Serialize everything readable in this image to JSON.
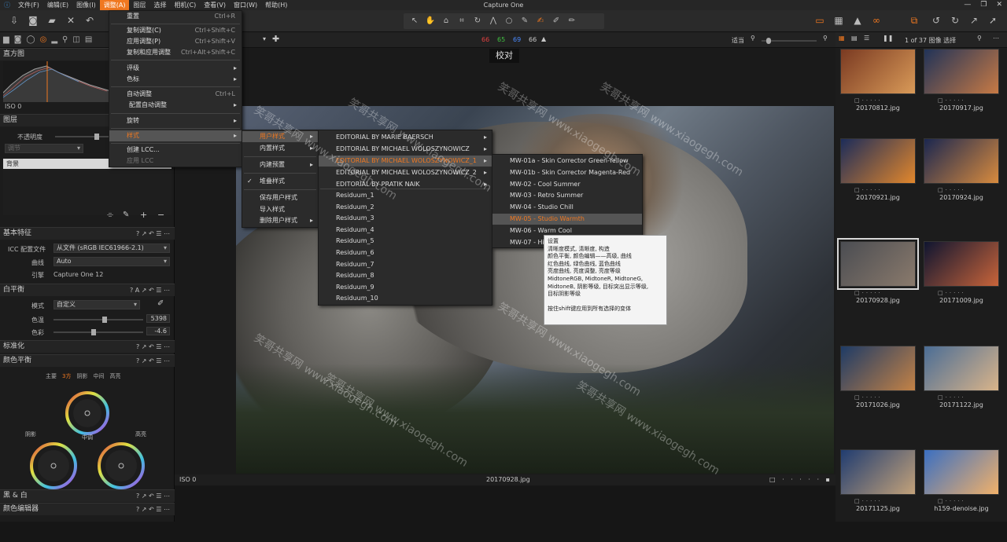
{
  "app": {
    "title": "Capture One"
  },
  "menubar": {
    "items": [
      "文件(F)",
      "编辑(E)",
      "图像(I)",
      "调整(A)",
      "图层",
      "选择",
      "相机(C)",
      "查看(V)",
      "窗口(W)",
      "帮助(H)"
    ],
    "active_index": 3
  },
  "viewer": {
    "label": "校对",
    "tabs_counts": [
      "66",
      "65",
      "69",
      "66"
    ],
    "fit_label": "适当",
    "filename": "20170928.jpg",
    "iso": "ISO 0"
  },
  "browser": {
    "count": "1 of 37 图像 选择"
  },
  "menus": {
    "adjust": [
      {
        "t": "重置",
        "s": "Ctrl+R"
      },
      {
        "t": "复制调整(C)",
        "s": "Ctrl+Shift+C"
      },
      {
        "t": "应用调整(P)",
        "s": "Ctrl+Shift+V"
      },
      {
        "t": "复制和应用调整",
        "s": "Ctrl+Alt+Shift+C"
      },
      {
        "t": "评级",
        "s": ""
      },
      {
        "t": "色标",
        "s": ""
      },
      {
        "t": "自动调整",
        "s": "Ctrl+L"
      },
      {
        "t": "配置自动调整",
        "s": ""
      },
      {
        "t": "旋转",
        "s": ""
      },
      {
        "t": "样式",
        "s": ""
      },
      {
        "t": "创建 LCC...",
        "s": ""
      },
      {
        "t": "应用 LCC",
        "s": ""
      }
    ],
    "styles": [
      "用户样式",
      "内置样式",
      "内建预置",
      "堆叠样式",
      "保存用户样式",
      "导入样式",
      "删除用户样式"
    ],
    "user_styles": [
      "EDITORIAL BY MARIE BAERSCH",
      "EDITORIAL BY MICHAEL WOLOSZYNOWICZ",
      "EDITORIAL BY MICHAEL WOLOSZYNOWICZ_1",
      "EDITORIAL BY MICHAEL WOLOSZYNOWICZ_2",
      "EDITORIAL BY PRATIK NAIK",
      "Residuum_1",
      "Residuum_2",
      "Residuum_3",
      "Residuum_4",
      "Residuum_5",
      "Residuum_6",
      "Residuum_7",
      "Residuum_8",
      "Residuum_9",
      "Residuum_10"
    ],
    "mw": [
      "MW-01a - Skin Corrector Green-Yellow",
      "MW-01b - Skin Corrector Magenta-Red",
      "MW-02 - Cool Summer",
      "MW-03 - Retro Summer",
      "MW-04 - Studio Chill",
      "MW-05 - Studio Warmth",
      "MW-06 - Warm Cool",
      "MW-07 - Hi"
    ]
  },
  "tooltip": {
    "lines": [
      "设置",
      "清晰度模式, 清晰度, 构造",
      "颜色平衡, 颜色编辑——高级, 曲线",
      "红色曲线, 绿色曲线, 蓝色曲线",
      "亮度曲线, 亮度调整, 亮度等级",
      "MidtoneRGB, MidtoneR, MidtoneG,",
      "MidtoneB, 阴影等级, 目标突出显示等级,",
      "目标阴影等级",
      "",
      "按住shift键应用到所有选择的变体"
    ]
  },
  "left": {
    "histogram": "直方图",
    "iso": "ISO 0",
    "layers": "图层",
    "opacity": "不透明度",
    "layer_bg": "背景",
    "layer_mode": "调节",
    "basic": "基本特征",
    "icc_label": "ICC 配置文件",
    "icc_value": "从文件 (sRGB IEC61966-2.1)",
    "curve_label": "曲线",
    "curve_value": "Auto",
    "engine_label": "引擎",
    "engine_value": "Capture One 12",
    "wb": "白平衡",
    "mode_label": "模式",
    "mode_value": "自定义",
    "temp_label": "色温",
    "temp_value": "5398",
    "tint_label": "色彩",
    "tint_value": "-4.6",
    "normalize": "标准化",
    "cb": "颜色平衡",
    "cb_tabs": [
      "主要",
      "3方",
      "阴影",
      "中间",
      "高亮"
    ],
    "shadow": "阴影",
    "mid": "中调",
    "high": "高亮",
    "bw": "黑 & 白",
    "coloreditor": "颜色编辑器"
  },
  "thumbs": [
    {
      "name": "20170812.jpg",
      "c1": "#7a3a22",
      "c2": "#d99a58"
    },
    {
      "name": "20170917.jpg",
      "c1": "#213358",
      "c2": "#c77a45"
    },
    {
      "name": "20170921.jpg",
      "c1": "#1c2c5a",
      "c2": "#e2872c"
    },
    {
      "name": "20170924.jpg",
      "c1": "#1b2750",
      "c2": "#d88b3e"
    },
    {
      "name": "20170928.jpg",
      "c1": "#4b4d52",
      "c2": "#8a7a6c"
    },
    {
      "name": "20171009.jpg",
      "c1": "#0f1530",
      "c2": "#c8643a"
    },
    {
      "name": "20171026.jpg",
      "c1": "#1e3b66",
      "c2": "#c38246"
    },
    {
      "name": "20171122.jpg",
      "c1": "#4b6d95",
      "c2": "#d9b48a"
    },
    {
      "name": "20171125.jpg",
      "c1": "#203c70",
      "c2": "#c3a27a"
    },
    {
      "name": "h159-denoise.jpg",
      "c1": "#3b6fc1",
      "c2": "#f1b16a"
    }
  ],
  "watermark": "笑哥共享网 www.xiaogegh.com",
  "colors": {
    "accent": "#f07820",
    "bg": "#161616",
    "panel": "#1c1c1c"
  }
}
